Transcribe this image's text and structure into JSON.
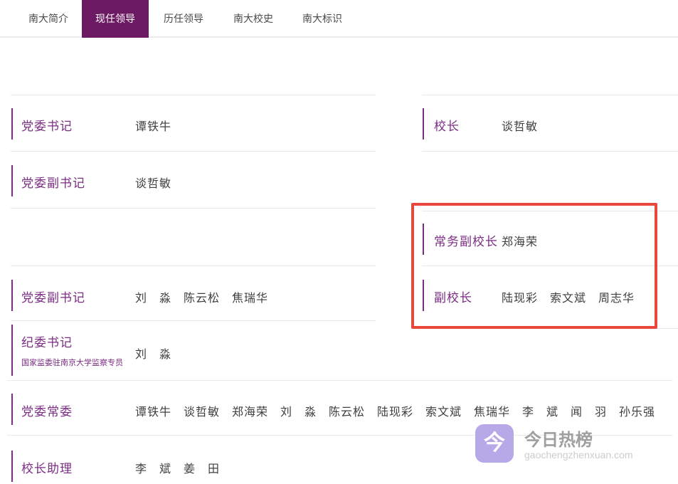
{
  "nav": {
    "tabs": [
      {
        "label": "南大简介",
        "active": false
      },
      {
        "label": "现任领导",
        "active": true
      },
      {
        "label": "历任领导",
        "active": false
      },
      {
        "label": "南大校史",
        "active": false
      },
      {
        "label": "南大标识",
        "active": false
      }
    ]
  },
  "left_column": {
    "rows": [
      {
        "title": "党委书记",
        "names": "谭铁牛"
      },
      {
        "title": "党委副书记",
        "names": "谈哲敏"
      },
      {
        "title": "党委副书记",
        "names": "刘　淼　陈云松　焦瑞华"
      },
      {
        "title": "纪委书记",
        "subtitle": "国家监委驻南京大学监察专员",
        "names": "刘　淼"
      }
    ]
  },
  "right_column": {
    "rows": [
      {
        "title": "校长",
        "names": "谈哲敏"
      },
      {
        "title": "常务副校长",
        "names": "郑海荣",
        "highlighted": true
      },
      {
        "title": "副校长",
        "names": "陆现彩　索文斌　周志华",
        "highlighted": true
      }
    ]
  },
  "bottom_rows": [
    {
      "title": "党委常委",
      "names": "谭铁牛　谈哲敏　郑海荣　刘　淼　陈云松　陆现彩　索文斌　焦瑞华　李　斌　闻　羽　孙乐强"
    },
    {
      "title": "校长助理",
      "names": "李　斌　姜　田"
    }
  ],
  "watermark": {
    "logo_glyph": "今",
    "title": "今日热榜",
    "domain": "gaochengzhenxuan.com"
  },
  "colors": {
    "accent_purple": "#6d1a64",
    "label_purple": "#7b2d84",
    "name_gray": "#3f3f3f",
    "divider_gray": "#e9e9e9",
    "highlight_red": "#e8473c",
    "watermark_purple": "#b7a8e8"
  }
}
